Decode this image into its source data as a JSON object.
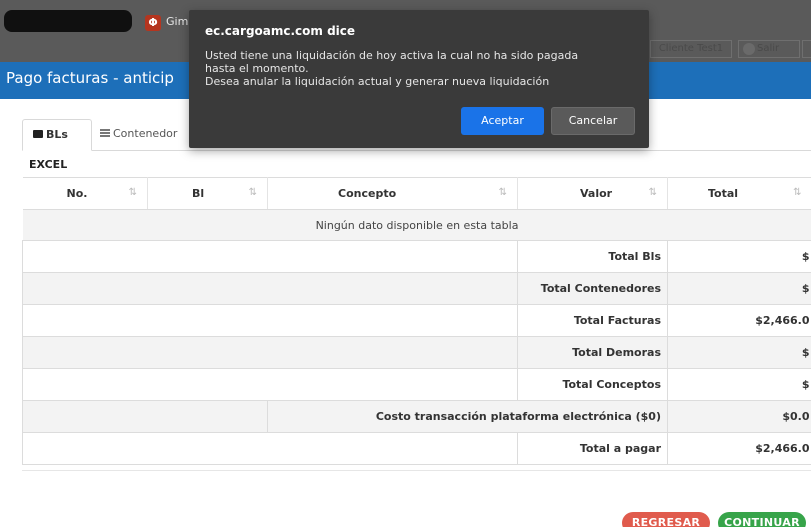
{
  "topbar": {
    "app_link": "Gim",
    "client_label": "Cliente Test1",
    "logout_label": "Salir"
  },
  "page": {
    "title": "Pago facturas - anticip"
  },
  "tabs": [
    {
      "label": "BLs",
      "active": true
    },
    {
      "label": "Contenedor",
      "active": false
    }
  ],
  "excel_label": "EXCEL",
  "table": {
    "columns": [
      "No.",
      "Bl",
      "Concepto",
      "Valor",
      "Total"
    ],
    "empty_message": "Ningún dato disponible en esta tabla",
    "summary": [
      {
        "label": "Total Bls",
        "value": "$"
      },
      {
        "label": "Total Contenedores",
        "value": "$"
      },
      {
        "label": "Total Facturas",
        "value": "$2,466.0"
      },
      {
        "label": "Total Demoras",
        "value": "$"
      },
      {
        "label": "Total Conceptos",
        "value": "$"
      },
      {
        "label": "Costo transacción plataforma electrónica ($0)",
        "value": "$0.0"
      },
      {
        "label": "Total a pagar",
        "value": "$2,466.0"
      }
    ]
  },
  "buttons": {
    "back": "REGRESAR",
    "continue": "CONTINUAR"
  },
  "dialog": {
    "title": "ec.cargoamc.com dice",
    "message_line1": "Usted tiene una liquidación de hoy activa la cual no ha sido pagada",
    "message_line2": "hasta el momento.",
    "message_line3": "Desea anular la liquidación actual y generar nueva liquidación",
    "accept": "Aceptar",
    "cancel": "Cancelar"
  },
  "colors": {
    "title_band": "#1d6fb9",
    "back_button": "#e05b4d",
    "continue_button": "#37a44a",
    "dialog_bg": "#3a3a3a",
    "accept_button": "#1a73e8"
  }
}
